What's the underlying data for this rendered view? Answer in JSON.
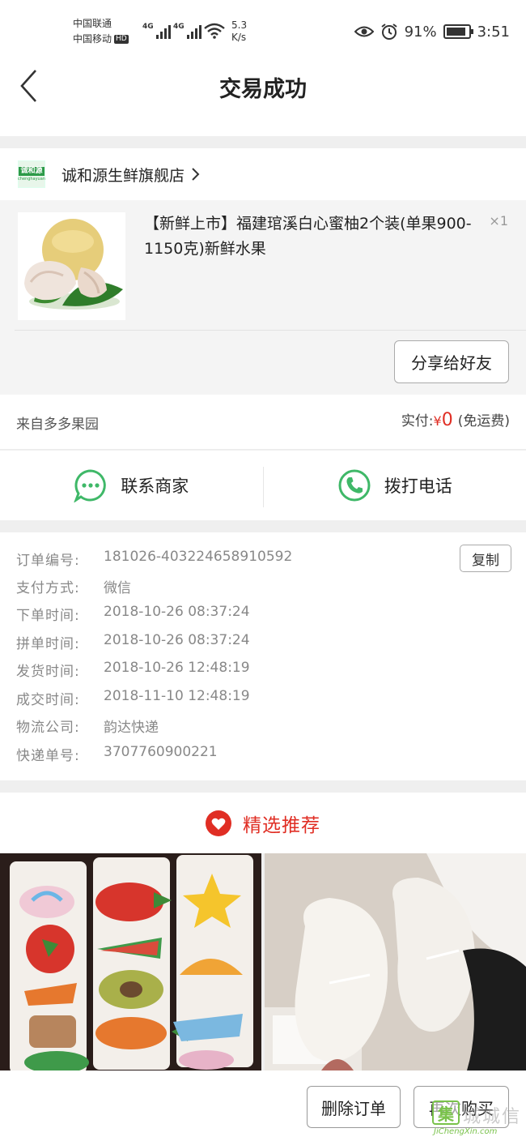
{
  "status_bar": {
    "carrier1": "中国联通",
    "carrier2": "中国移动",
    "hd_badge": "HD",
    "net1": "4G",
    "net2": "4G",
    "speed_value": "5.3",
    "speed_unit": "K/s",
    "battery": "91%",
    "time": "3:51"
  },
  "nav": {
    "title": "交易成功"
  },
  "shop": {
    "logo_text": "诚和源",
    "logo_sub": "chenghayuan",
    "name": "诚和源生鲜旗舰店"
  },
  "product": {
    "title": "【新鲜上市】福建琯溪白心蜜柚2个装(单果900-1150克)新鲜水果",
    "quantity": "×1",
    "share_label": "分享给好友"
  },
  "payment": {
    "source": "来自多多果园",
    "paid_label": "实付:",
    "currency": "¥",
    "amount": "0",
    "shipping_note": "(免运费)"
  },
  "contact": {
    "merchant_label": "联系商家",
    "phone_label": "拨打电话"
  },
  "order_info": {
    "copy_label": "复制",
    "rows": [
      {
        "label": "订单编号:",
        "value": "181026-403224658910592"
      },
      {
        "label": "支付方式:",
        "value": "微信"
      },
      {
        "label": "下单时间:",
        "value": "2018-10-26 08:37:24"
      },
      {
        "label": "拼单时间:",
        "value": "2018-10-26 08:37:24"
      },
      {
        "label": "发货时间:",
        "value": "2018-10-26 12:48:19"
      },
      {
        "label": "成交时间:",
        "value": "2018-11-10 12:48:19"
      },
      {
        "label": "物流公司:",
        "value": "韵达快递"
      },
      {
        "label": "快递单号:",
        "value": "3707760900221"
      }
    ]
  },
  "recommend": {
    "title": "精选推荐"
  },
  "bottom": {
    "delete_label": "删除订单",
    "rebuy_label": "再次购买"
  },
  "watermark": {
    "mark": "集",
    "cn": "城城信",
    "en": "JiChengXin.com"
  },
  "colors": {
    "accent": "#e02e24",
    "wechat_green": "#3fb868"
  }
}
